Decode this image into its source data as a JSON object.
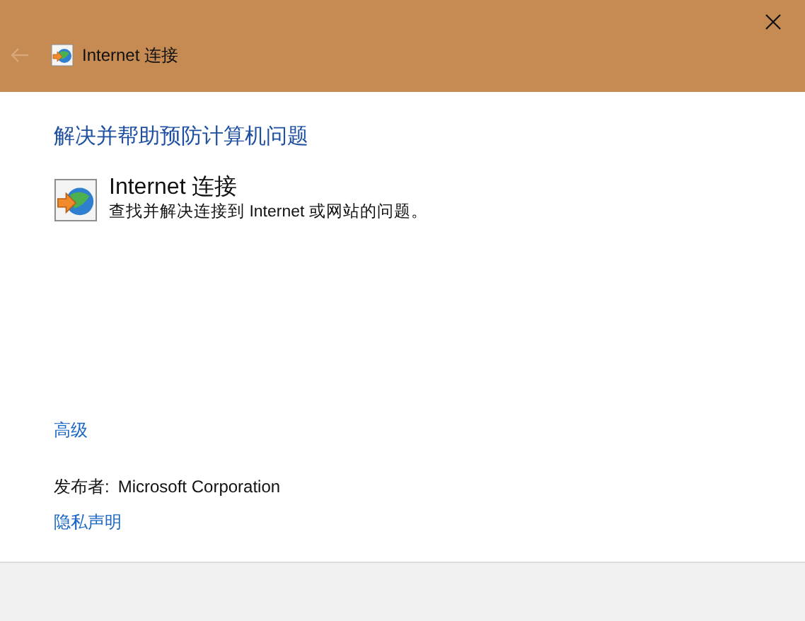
{
  "window": {
    "title": "Internet 连接",
    "back_disabled": true
  },
  "heading": "解决并帮助预防计算机问题",
  "troubleshooter": {
    "title": "Internet 连接",
    "description": "查找并解决连接到 Internet 或网站的问题。"
  },
  "advanced_link": "高级",
  "publisher": {
    "label": "发布者:",
    "value": "Microsoft Corporation"
  },
  "privacy_link": "隐私声明"
}
